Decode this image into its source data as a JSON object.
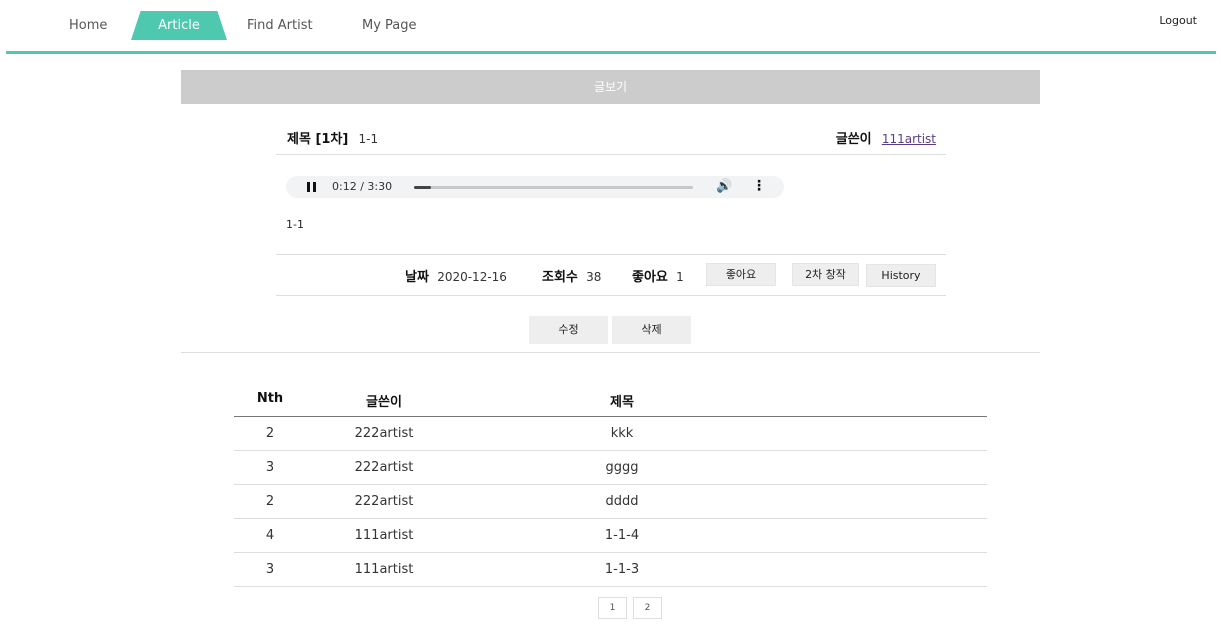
{
  "nav": {
    "home": "Home",
    "article": "Article",
    "find_artist": "Find Artist",
    "my_page": "My Page",
    "logout": "Logout"
  },
  "view_header": "글보기",
  "article": {
    "title_label": "제목 [1차]",
    "title_value": "1-1",
    "author_label": "글쓴이",
    "author_value": "111artist",
    "audio": {
      "time": "0:12 / 3:30",
      "progress_fraction": 0.06
    },
    "content": "1-1",
    "date_label": "날짜",
    "date_value": "2020-12-16",
    "views_label": "조회수",
    "views_value": "38",
    "likes_label": "좋아요",
    "likes_value": "1",
    "like_button": "좋아요",
    "second_creation_button": "2차 창작",
    "history_button": "History",
    "edit_button": "수정",
    "delete_button": "삭제"
  },
  "table": {
    "headers": [
      "Nth",
      "글쓴이",
      "제목"
    ],
    "rows": [
      [
        "2",
        "222artist",
        "kkk"
      ],
      [
        "3",
        "222artist",
        "gggg"
      ],
      [
        "2",
        "222artist",
        "dddd"
      ],
      [
        "4",
        "111artist",
        "1-1-4"
      ],
      [
        "3",
        "111artist",
        "1-1-3"
      ]
    ]
  },
  "pagination": [
    "1",
    "2"
  ],
  "colors": {
    "accent": "#4ec9b0",
    "header_bar": "#cccccc"
  }
}
